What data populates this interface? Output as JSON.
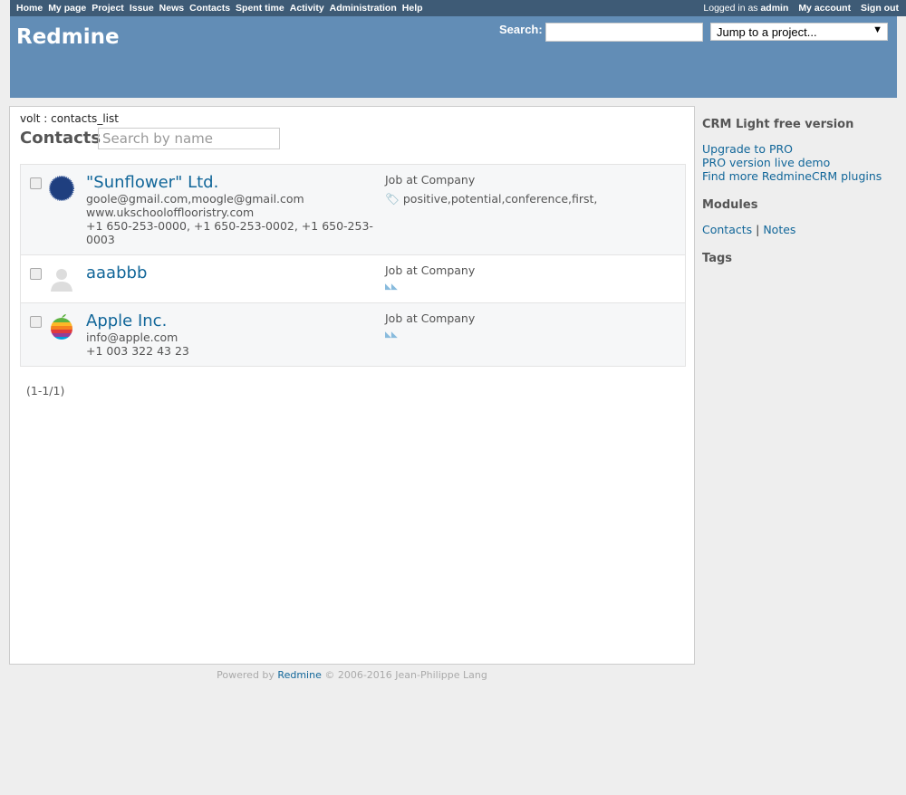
{
  "top_menu": {
    "items": [
      "Home",
      "My page",
      "Project",
      "Issue",
      "News",
      "Contacts",
      "Spent time",
      "Activity",
      "Administration",
      "Help"
    ],
    "logged_in_label": "Logged in as",
    "user": "admin",
    "my_account": "My account",
    "sign_out": "Sign out"
  },
  "header": {
    "title": "Redmine",
    "search_label": "Search:",
    "search_value": "",
    "jump": "Jump to a project..."
  },
  "main": {
    "breadcrumb": "volt : contacts_list",
    "title": "Contacts",
    "search_placeholder": "Search by name",
    "contacts": [
      {
        "name": "\"Sunflower\" Ltd.",
        "details": [
          "goole@gmail.com,moogle@gmail.com",
          "www.ukschoolofflooristry.com",
          "+1 650-253-0000, +1 650-253-0002, +1 650-253-0003"
        ],
        "job": "Job at Company",
        "tags": "positive,potential,conference,first,"
      },
      {
        "name": "aaabbb",
        "details": [],
        "job": "Job at Company",
        "tags": ""
      },
      {
        "name": "Apple Inc.",
        "details": [
          "info@apple.com",
          "+1 003 322 43 23"
        ],
        "job": "Job at Company",
        "tags": ""
      }
    ],
    "pagination": "(1-1/1)"
  },
  "sidebar": {
    "crm_title": "CRM Light free version",
    "links": [
      "Upgrade to PRO",
      "PRO version live demo",
      "Find more RedmineCRM plugins"
    ],
    "modules_title": "Modules",
    "modules": [
      "Contacts",
      "Notes"
    ],
    "tags_title": "Tags"
  },
  "footer": {
    "prefix": "Powered by",
    "link": "Redmine",
    "suffix": "© 2006-2016 Jean-Philippe Lang"
  }
}
